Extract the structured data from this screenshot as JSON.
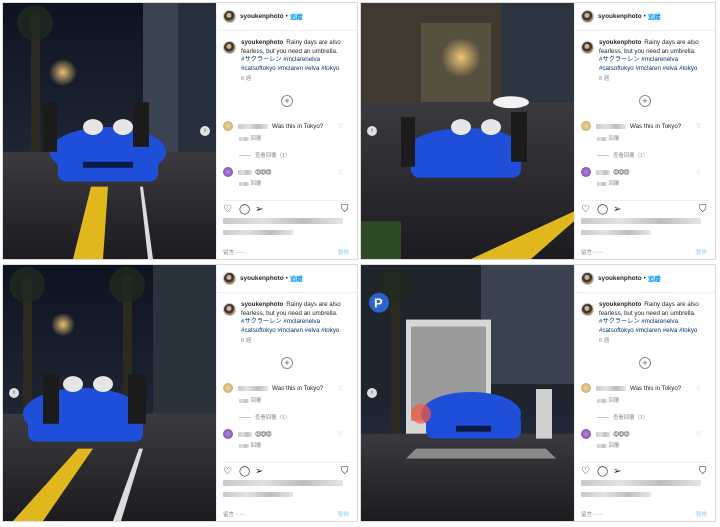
{
  "posts": [
    {
      "username": "syoukenphoto",
      "follow_label": "追蹤",
      "caption": "Rainy days are also fearless, but you need an umbrella.",
      "hashtags": "#サクラーレン #mclarenelva #catsoftokyo #mclaren #elva #tokyo",
      "time_ago": "8 週",
      "comment1": "Was this in Tokyo?",
      "comment1_meta": "回覆",
      "replies_label": "查看回覆（1）",
      "comment2_emoji": "😍😍😍",
      "comment2_meta": "回覆",
      "add_comment": "留言⋯⋯",
      "post_label": "發佈"
    },
    {
      "username": "syoukenphoto",
      "follow_label": "追蹤",
      "caption": "Rainy days are also fearless, but you need an umbrella.",
      "hashtags": "#サクラーレン #mclarenelva #catsoftokyo #mclaren #elva #tokyo",
      "time_ago": "8 週",
      "comment1": "Was this in Tokyo?",
      "comment1_meta": "回覆",
      "replies_label": "查看回覆（1）",
      "comment2_emoji": "😍😍😍",
      "comment2_meta": "回覆",
      "add_comment": "留言⋯⋯",
      "post_label": "發佈"
    },
    {
      "username": "syoukenphoto",
      "follow_label": "追蹤",
      "caption": "Rainy days are also fearless, but you need an umbrella.",
      "hashtags": "#サクラーレン #mclarenelva #catsoftokyo #mclaren #elva #tokyo",
      "time_ago": "8 週",
      "comment1": "Was this in Tokyo?",
      "comment1_meta": "回覆",
      "replies_label": "查看回覆（1）",
      "comment2_emoji": "😍😍😍",
      "comment2_meta": "回覆",
      "add_comment": "留言⋯⋯",
      "post_label": "發佈"
    },
    {
      "username": "syoukenphoto",
      "follow_label": "追蹤",
      "caption": "Rainy days are also fearless, but you need an umbrella.",
      "hashtags": "#サクラーレン #mclarenelva #catsoftokyo #mclaren #elva #tokyo",
      "time_ago": "8 週",
      "comment1": "Was this in Tokyo?",
      "comment1_meta": "回覆",
      "replies_label": "查看回覆（1）",
      "comment2_emoji": "😍😍😍",
      "comment2_meta": "回覆",
      "add_comment": "留言⋯⋯",
      "post_label": "發佈"
    }
  ],
  "icons": {
    "plus": "plus-circle-icon",
    "like": "heart-icon",
    "comment": "comment-bubble-icon",
    "share": "paper-plane-icon",
    "save": "bookmark-icon",
    "carousel_prev": "chevron-left-icon",
    "carousel_next": "chevron-right-icon"
  },
  "colors": {
    "follow_blue": "#0095f6",
    "car_blue": "#1f4fd8",
    "tactile_yellow": "#e0b81d"
  },
  "photo_text": {
    "parking_sign": "P"
  }
}
